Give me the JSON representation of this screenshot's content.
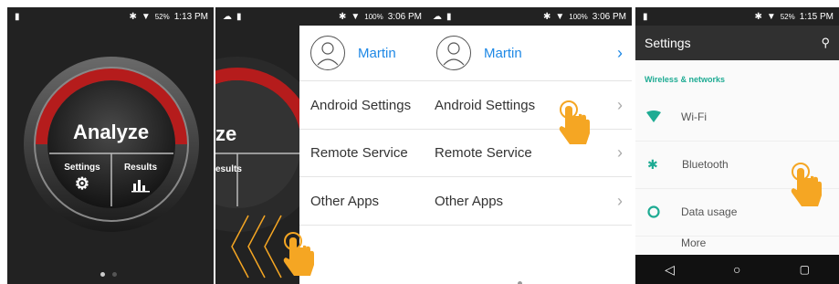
{
  "panel1": {
    "status": {
      "battery": "52%",
      "time": "1:13 PM"
    },
    "analyze_label": "Analyze",
    "settings_label": "Settings",
    "results_label": "Results"
  },
  "panel2": {
    "status": {
      "battery": "100%",
      "time": "3:06 PM"
    },
    "user_name": "Martin",
    "partial_dial_text": "ze",
    "partial_results": "esults",
    "menu": [
      "Android Settings",
      "Remote Service",
      "Other Apps"
    ]
  },
  "panel3": {
    "status": {
      "battery": "100%",
      "time": "3:06 PM"
    },
    "user_name": "Martin",
    "menu": [
      "Android Settings",
      "Remote Service",
      "Other Apps"
    ]
  },
  "panel4": {
    "status": {
      "battery": "52%",
      "time": "1:15 PM"
    },
    "title": "Settings",
    "section": "Wireless & networks",
    "rows": [
      "Wi-Fi",
      "Bluetooth",
      "Data usage",
      "More"
    ]
  },
  "colors": {
    "accent_blue": "#1e88e5",
    "teal": "#1eab93",
    "hand_orange": "#f5a623",
    "dial_red": "#b51c1c"
  }
}
